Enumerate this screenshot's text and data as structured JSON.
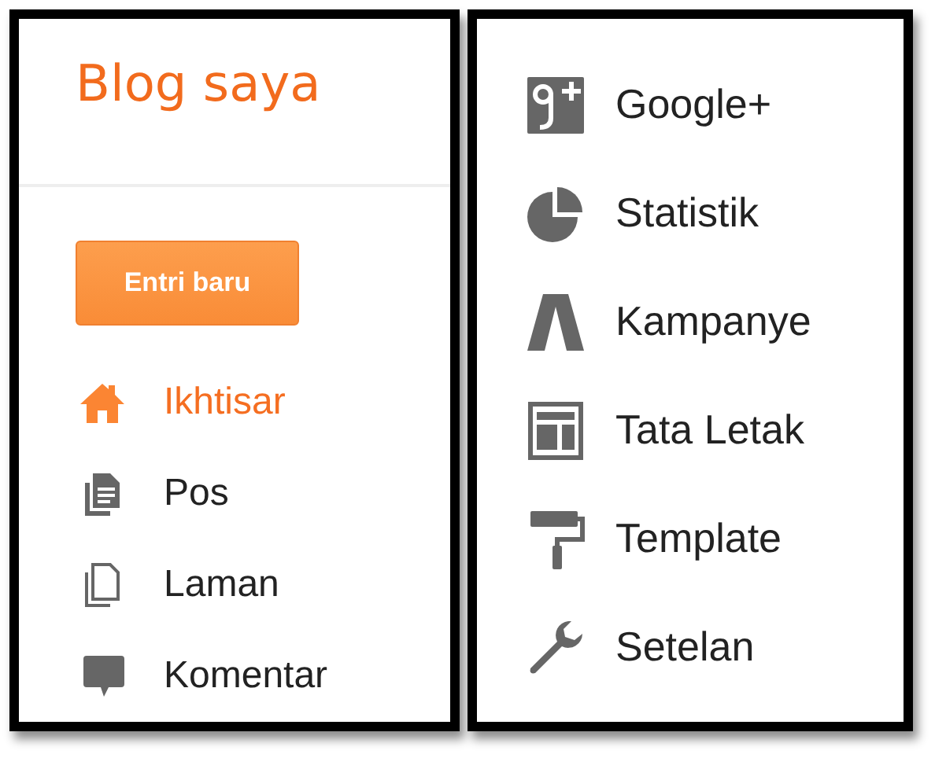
{
  "blog_title": "Blog saya",
  "new_post_button": "Entri baru",
  "menu_left": [
    {
      "label": "Ikhtisar",
      "selected": true
    },
    {
      "label": "Pos",
      "selected": false
    },
    {
      "label": "Laman",
      "selected": false
    },
    {
      "label": "Komentar",
      "selected": false
    }
  ],
  "menu_right": [
    {
      "label": "Google+",
      "selected": false
    },
    {
      "label": "Statistik",
      "selected": false
    },
    {
      "label": "Kampanye",
      "selected": false
    },
    {
      "label": "Tata Letak",
      "selected": false
    },
    {
      "label": "Template",
      "selected": false
    },
    {
      "label": "Setelan",
      "selected": false
    }
  ]
}
